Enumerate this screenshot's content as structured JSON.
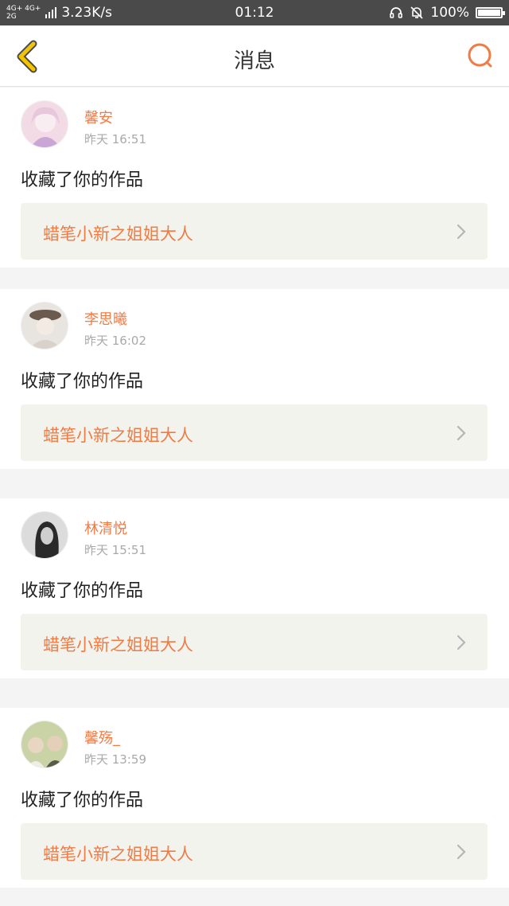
{
  "status_bar": {
    "network_top": "4G+ 4G+",
    "network_bottom": "2G",
    "speed": "3.23K/s",
    "time": "01:12",
    "battery": "100%",
    "battery_level": 1.0,
    "icons": [
      "headset-icon",
      "bell-muted-icon",
      "battery-icon"
    ]
  },
  "header": {
    "title": "消息",
    "back_icon": "chevron-left-icon",
    "search_icon": "search-icon",
    "accent": "#f07b44",
    "back_color": "#f5c400"
  },
  "messages": [
    {
      "username": "馨安",
      "time": "昨天 16:51",
      "action": "收藏了你的作品",
      "work_title": "蜡笔小新之姐姐大人",
      "avatar_colors": [
        "#f3dbe6",
        "#c9a6d6"
      ]
    },
    {
      "username": "李思曦",
      "time": "昨天 16:02",
      "action": "收藏了你的作品",
      "work_title": "蜡笔小新之姐姐大人",
      "avatar_colors": [
        "#e8e4df",
        "#6b5a4e"
      ]
    },
    {
      "username": "林清悦",
      "time": "昨天 15:51",
      "action": "收藏了你的作品",
      "work_title": "蜡笔小新之姐姐大人",
      "avatar_colors": [
        "#dcdcdc",
        "#2a2a2a"
      ]
    },
    {
      "username": "馨殇_",
      "time": "昨天 13:59",
      "action": "收藏了你的作品",
      "work_title": "蜡笔小新之姐姐大人",
      "avatar_colors": [
        "#c9d3a6",
        "#5a5a4a"
      ]
    }
  ]
}
